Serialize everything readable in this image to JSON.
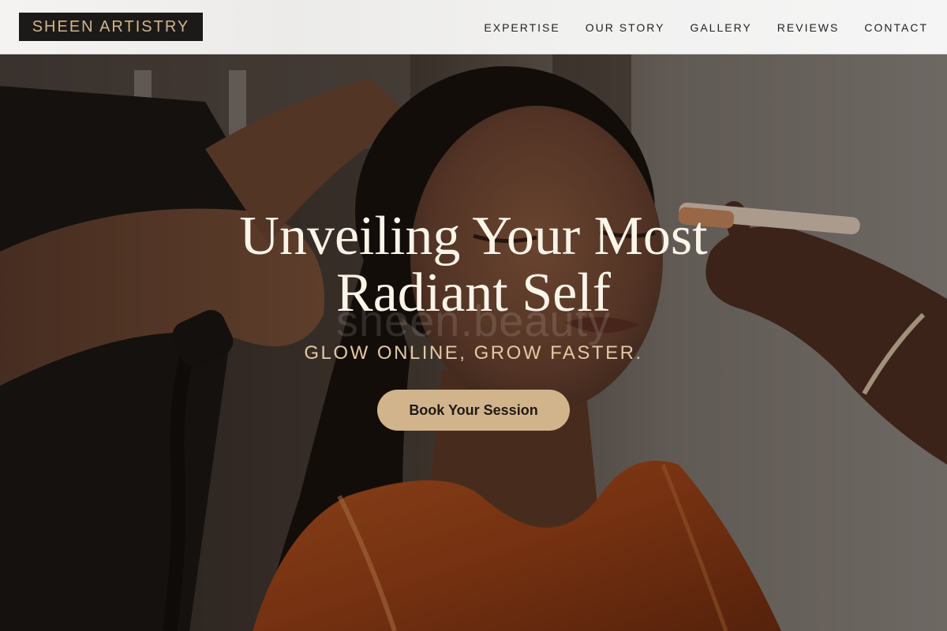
{
  "header": {
    "logo": "SHEEN ARTISTRY",
    "nav": [
      {
        "label": "EXPERTISE"
      },
      {
        "label": "OUR STORY"
      },
      {
        "label": "GALLERY"
      },
      {
        "label": "REVIEWS"
      },
      {
        "label": "CONTACT"
      }
    ]
  },
  "hero": {
    "title_line1": "Unveiling Your Most",
    "title_line2": "Radiant Self",
    "watermark": "sheen.beauty",
    "tagline": "GLOW ONLINE, GROW FASTER.",
    "cta_label": "Book Your Session",
    "image_alt": "Makeup artist applying makeup to a woman in an orange satin robe"
  },
  "colors": {
    "accent": "#d2b48c",
    "logo_bg": "#1c1a18",
    "title": "#fbf4e8",
    "nav_text": "#222222"
  }
}
